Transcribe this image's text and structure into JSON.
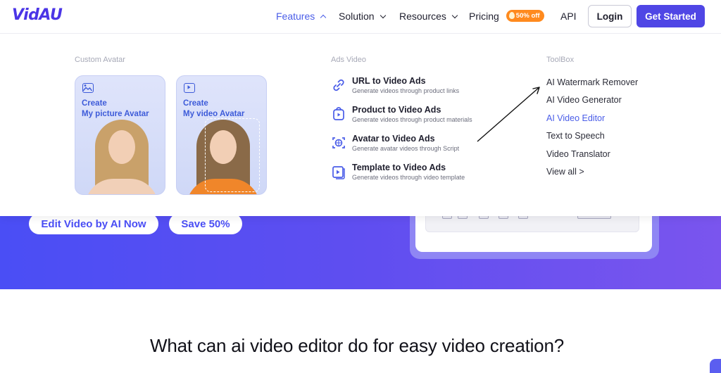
{
  "header": {
    "logo": "VidAU",
    "nav": [
      {
        "label": "Features"
      },
      {
        "label": "Solution"
      },
      {
        "label": "Resources"
      },
      {
        "label": "Pricing",
        "badge": "50% off"
      },
      {
        "label": "API"
      }
    ],
    "login": "Login",
    "get_started": "Get Started"
  },
  "dropdown": {
    "custom_avatar": {
      "title": "Custom Avatar",
      "cards": [
        {
          "line1": "Create",
          "line2": "My picture Avatar",
          "icon": "image-icon"
        },
        {
          "line1": "Create",
          "line2": "My video Avatar",
          "icon": "play-icon"
        }
      ]
    },
    "ads_video": {
      "title": "Ads Video",
      "items": [
        {
          "title": "URL to Video Ads",
          "desc": "Generate videos through product links",
          "icon": "link-icon"
        },
        {
          "title": "Product to Video Ads",
          "desc": "Generate videos through product materials",
          "icon": "product-video-icon"
        },
        {
          "title": "Avatar to Video Ads",
          "desc": "Generate avatar videos through Script",
          "icon": "avatar-scan-icon"
        },
        {
          "title": "Template to Video Ads",
          "desc": "Generate videos through video template",
          "icon": "template-video-icon"
        }
      ]
    },
    "toolbox": {
      "title": "ToolBox",
      "items": [
        {
          "label": "AI Watermark Remover"
        },
        {
          "label": "AI Video Generator"
        },
        {
          "label": "AI Video Editor"
        },
        {
          "label": "Text to Speech"
        },
        {
          "label": "Video Translator"
        },
        {
          "label": "View all >"
        }
      ]
    }
  },
  "hero": {
    "primary_button": "Edit Video by AI Now",
    "secondary_button": "Save 50%"
  },
  "section": {
    "heading": "What can ai video editor do for easy video creation?"
  },
  "colors": {
    "brand": "#4f46e5",
    "link_active": "#4a5de8",
    "badge": "#ff8a1e"
  }
}
